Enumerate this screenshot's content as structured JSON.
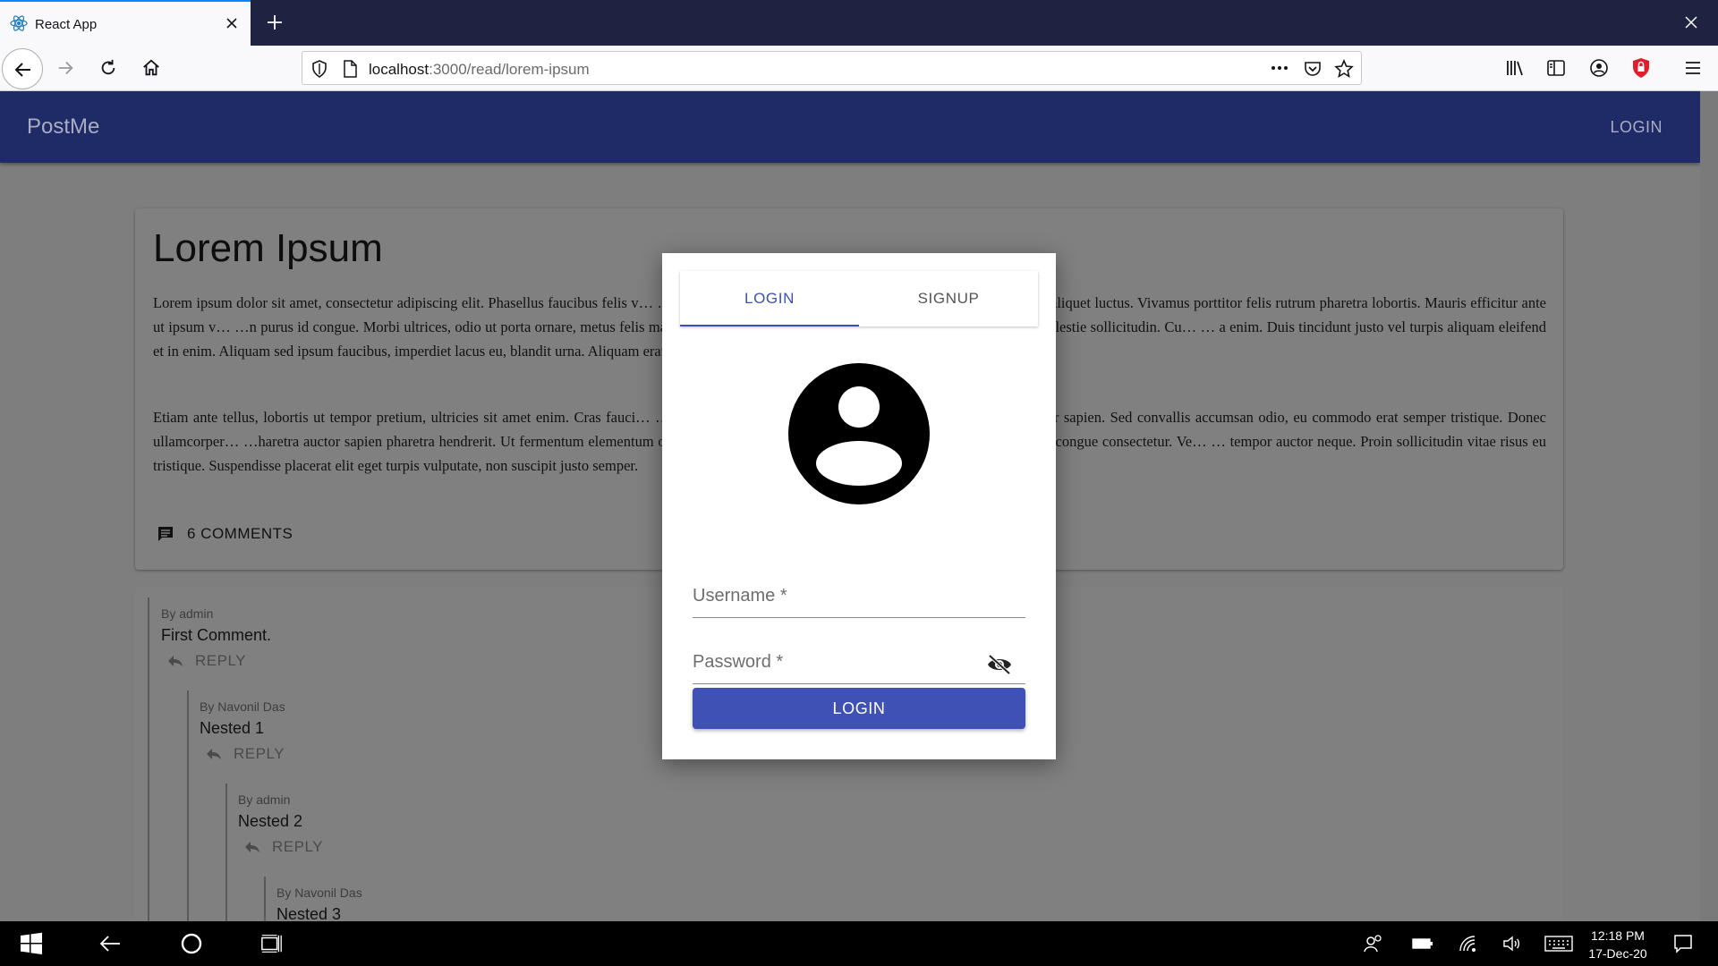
{
  "browser": {
    "tab_title": "React App",
    "url_host": "localhost",
    "url_rest": ":3000/read/lorem-ipsum"
  },
  "app": {
    "brand": "PostMe",
    "login_link": "LOGIN"
  },
  "post": {
    "title": "Lorem Ipsum",
    "paragraph1": "Lorem ipsum dolor sit amet, consectetur adipiscing elit. Phasellus faucibus felis v…                                                                                   …ue iaculis odio id vulputate vestibulum. Nam quis elit sed justo aliquet luctus. Vivamus porttitor felis rutrum pharetra lobortis. Mauris efficitur ante ut ipsum v…                                                                                   …n purus id congue. Morbi ultrices, odio ut porta ornare, metus felis maximus diam, vel dictum leo libero molestie dui. Donec iaculis molestie sollicitudin. Cu…                                                                                   … a enim. Duis tincidunt justo vel turpis aliquam eleifend et in enim. Aliquam sed ipsum faucibus, imperdiet lacus eu, blandit urna. Aliquam erat volutpat.",
    "paragraph2": "Etiam ante tellus, lobortis ut tempor pretium, ultricies sit amet enim. Cras fauci…                                                                                   …elerisque hendrerit. Sed at mi varius, sagittis orci a, ullamcorper sapien. Sed convallis accumsan odio, eu commodo erat semper tristique. Donec ullamcorper…                                                                                   …haretra auctor sapien pharetra hendrerit. Ut fermentum elementum odio, eget dictum urna elementum id. Aliquam dictum ipsum quis congue consectetur. Ve…                                                                                   … tempor auctor neque. Proin sollicitudin vitae risus eu tristique. Suspendisse placerat elit eget turpis vulputate, non suscipit justo semper.",
    "comments_label": "6 COMMENTS"
  },
  "comments": [
    {
      "by": "By admin",
      "body": "First Comment.",
      "reply": "REPLY"
    },
    {
      "by": "By Navonil Das",
      "body": "Nested 1",
      "reply": "REPLY"
    },
    {
      "by": "By admin",
      "body": "Nested 2",
      "reply": "REPLY"
    },
    {
      "by": "By Navonil Das",
      "body": "Nested 3",
      "reply": "REPLY"
    }
  ],
  "modal": {
    "tab_login": "LOGIN",
    "tab_signup": "SIGNUP",
    "username_label": "Username *",
    "password_label": "Password *",
    "submit": "LOGIN",
    "accent": "#3f51b5"
  },
  "taskbar": {
    "time": "12:18 PM",
    "date": "17-Dec-20"
  }
}
